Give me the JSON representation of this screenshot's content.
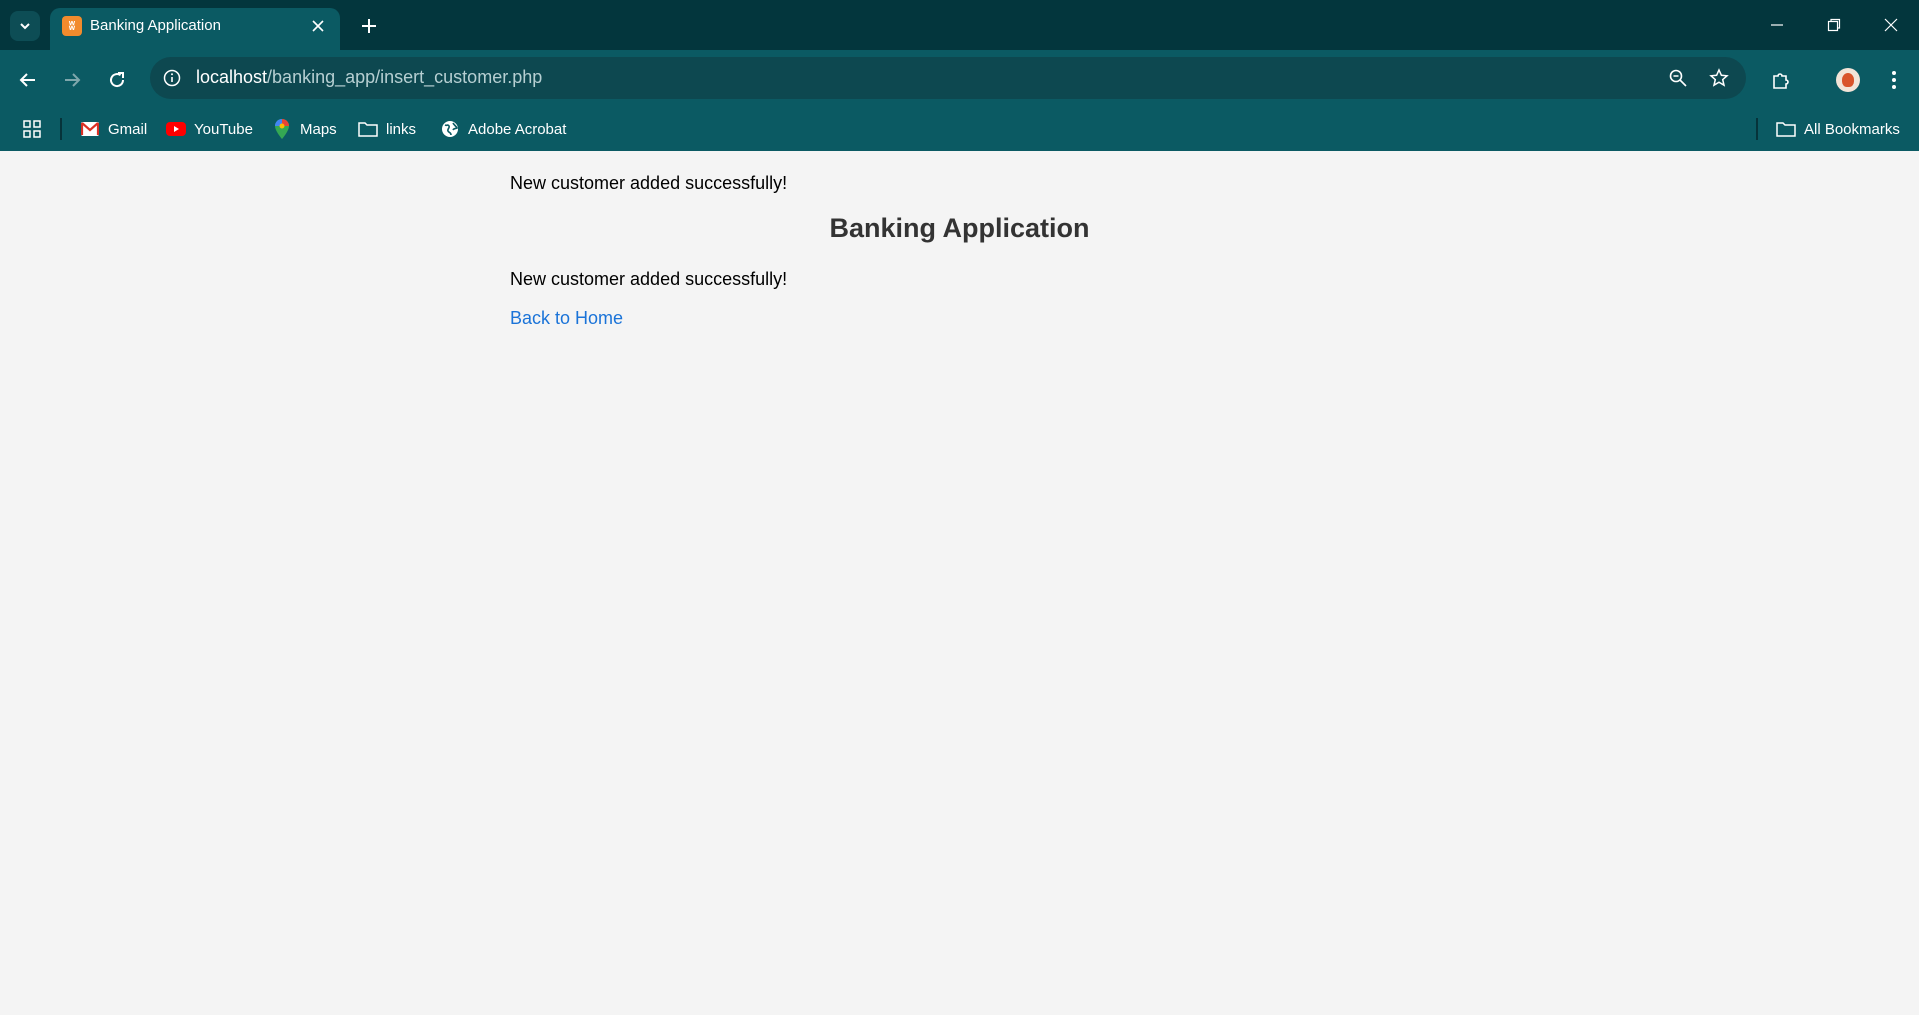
{
  "browser": {
    "tab": {
      "title": "Banking Application",
      "favicon": "xampp-icon"
    },
    "url": {
      "host": "localhost",
      "path": "/banking_app/insert_customer.php"
    },
    "bookmarks": [
      {
        "label": "Gmail",
        "icon": "gmail-icon"
      },
      {
        "label": "YouTube",
        "icon": "youtube-icon"
      },
      {
        "label": "Maps",
        "icon": "maps-icon"
      },
      {
        "label": "links",
        "icon": "folder-icon"
      },
      {
        "label": "Adobe Acrobat",
        "icon": "globe-icon"
      }
    ],
    "all_bookmarks": "All Bookmarks",
    "colors": {
      "frame": "#03363d",
      "toolbar": "#0b5a63"
    }
  },
  "page": {
    "top_message": "New customer added successfully!",
    "title": "Banking Application",
    "message": "New customer added successfully!",
    "back_link": "Back to Home",
    "colors": {
      "link": "#1a73d8",
      "background": "#f4f4f4"
    }
  }
}
